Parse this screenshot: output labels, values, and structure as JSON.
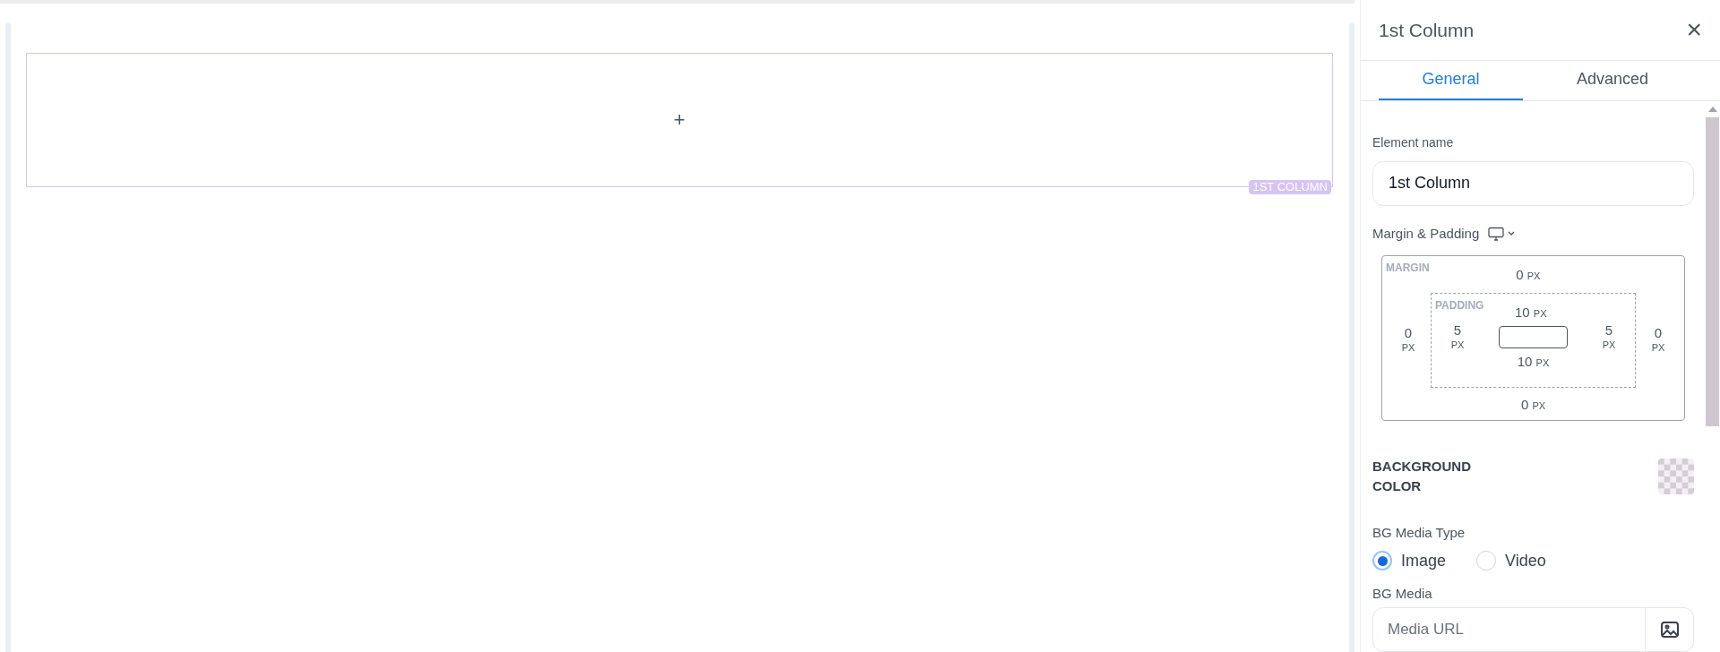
{
  "canvas": {
    "add_symbol": "+",
    "column_label": "1ST COLUMN"
  },
  "panel": {
    "title": "1st Column",
    "close_symbol": "×",
    "tabs": [
      {
        "label": "General",
        "selected": true
      },
      {
        "label": "Advanced",
        "selected": false
      }
    ],
    "element_name": {
      "label": "Element name",
      "value": "1st Column"
    },
    "spacing": {
      "label": "Margin & Padding",
      "margin_label": "MARGIN",
      "padding_label": "PADDING",
      "margin": {
        "top": {
          "value": "0",
          "unit": "PX"
        },
        "right": {
          "value": "0",
          "unit": "PX"
        },
        "bottom": {
          "value": "0",
          "unit": "PX"
        },
        "left": {
          "value": "0",
          "unit": "PX"
        }
      },
      "padding": {
        "top": {
          "value": "10",
          "unit": "PX"
        },
        "right": {
          "value": "5",
          "unit": "PX"
        },
        "bottom": {
          "value": "10",
          "unit": "PX"
        },
        "left": {
          "value": "5",
          "unit": "PX"
        }
      }
    },
    "background_color": {
      "label": "BACKGROUND COLOR"
    },
    "bg_media_type": {
      "label": "BG Media Type",
      "options": [
        {
          "label": "Image",
          "selected": true
        },
        {
          "label": "Video",
          "selected": false
        }
      ]
    },
    "bg_media": {
      "label": "BG Media",
      "placeholder": "Media URL"
    }
  }
}
